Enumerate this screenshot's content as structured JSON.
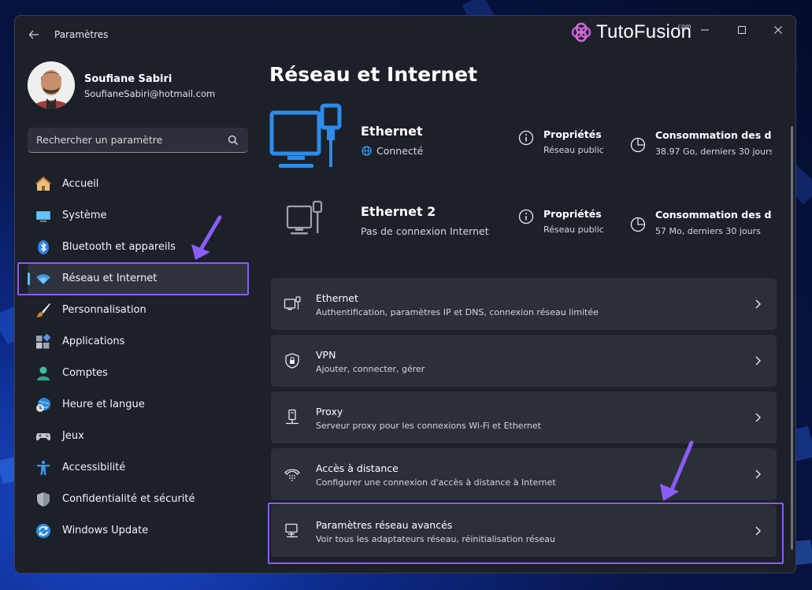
{
  "window": {
    "title": "Paramètres",
    "brand": "TutoFusion",
    "brand_suffix": ".com"
  },
  "profile": {
    "name": "Soufiane Sabiri",
    "email": "SoufianeSabiri@hotmail.com"
  },
  "search": {
    "placeholder": "Rechercher un paramètre"
  },
  "sidebar": {
    "items": [
      {
        "label": "Accueil",
        "icon": "home-icon"
      },
      {
        "label": "Système",
        "icon": "system-icon"
      },
      {
        "label": "Bluetooth et appareils",
        "icon": "bluetooth-icon"
      },
      {
        "label": "Réseau et Internet",
        "icon": "wifi-icon",
        "active": true
      },
      {
        "label": "Personnalisation",
        "icon": "brush-icon"
      },
      {
        "label": "Applications",
        "icon": "apps-icon"
      },
      {
        "label": "Comptes",
        "icon": "account-icon"
      },
      {
        "label": "Heure et langue",
        "icon": "time-language-icon"
      },
      {
        "label": "Jeux",
        "icon": "gamepad-icon"
      },
      {
        "label": "Accessibilité",
        "icon": "accessibility-icon"
      },
      {
        "label": "Confidentialité et sécurité",
        "icon": "shield-icon"
      },
      {
        "label": "Windows Update",
        "icon": "update-icon"
      }
    ]
  },
  "main": {
    "title": "Réseau et Internet",
    "connections": [
      {
        "name": "Ethernet",
        "status": "Connecté",
        "properties_title": "Propriétés",
        "properties_sub": "Réseau public",
        "usage_title": "Consommation des données",
        "usage_sub": "38.97 Go, derniers 30 jours"
      },
      {
        "name": "Ethernet 2",
        "status": "Pas de connexion Internet",
        "properties_title": "Propriétés",
        "properties_sub": "Réseau public",
        "usage_title": "Consommation des données",
        "usage_sub": "57 Mo, derniers 30 jours"
      }
    ],
    "cards": [
      {
        "title": "Ethernet",
        "subtitle": "Authentification, paramètres IP et DNS, connexion réseau limitée",
        "icon": "ethernet-icon"
      },
      {
        "title": "VPN",
        "subtitle": "Ajouter, connecter, gérer",
        "icon": "vpn-shield-icon"
      },
      {
        "title": "Proxy",
        "subtitle": "Serveur proxy pour les connexions Wi-Fi et Ethernet",
        "icon": "proxy-icon"
      },
      {
        "title": "Accès à distance",
        "subtitle": "Configurer une connexion d'accès à distance à Internet",
        "icon": "dial-up-icon"
      },
      {
        "title": "Paramètres réseau avancés",
        "subtitle": "Voir tous les adaptateurs réseau, réinitialisation réseau",
        "icon": "advanced-network-icon"
      }
    ]
  },
  "colors": {
    "accent": "#4cc2ff",
    "highlight": "#8b5cf6",
    "window_bg": "#1c2029",
    "card_bg": "#2b2f38"
  }
}
